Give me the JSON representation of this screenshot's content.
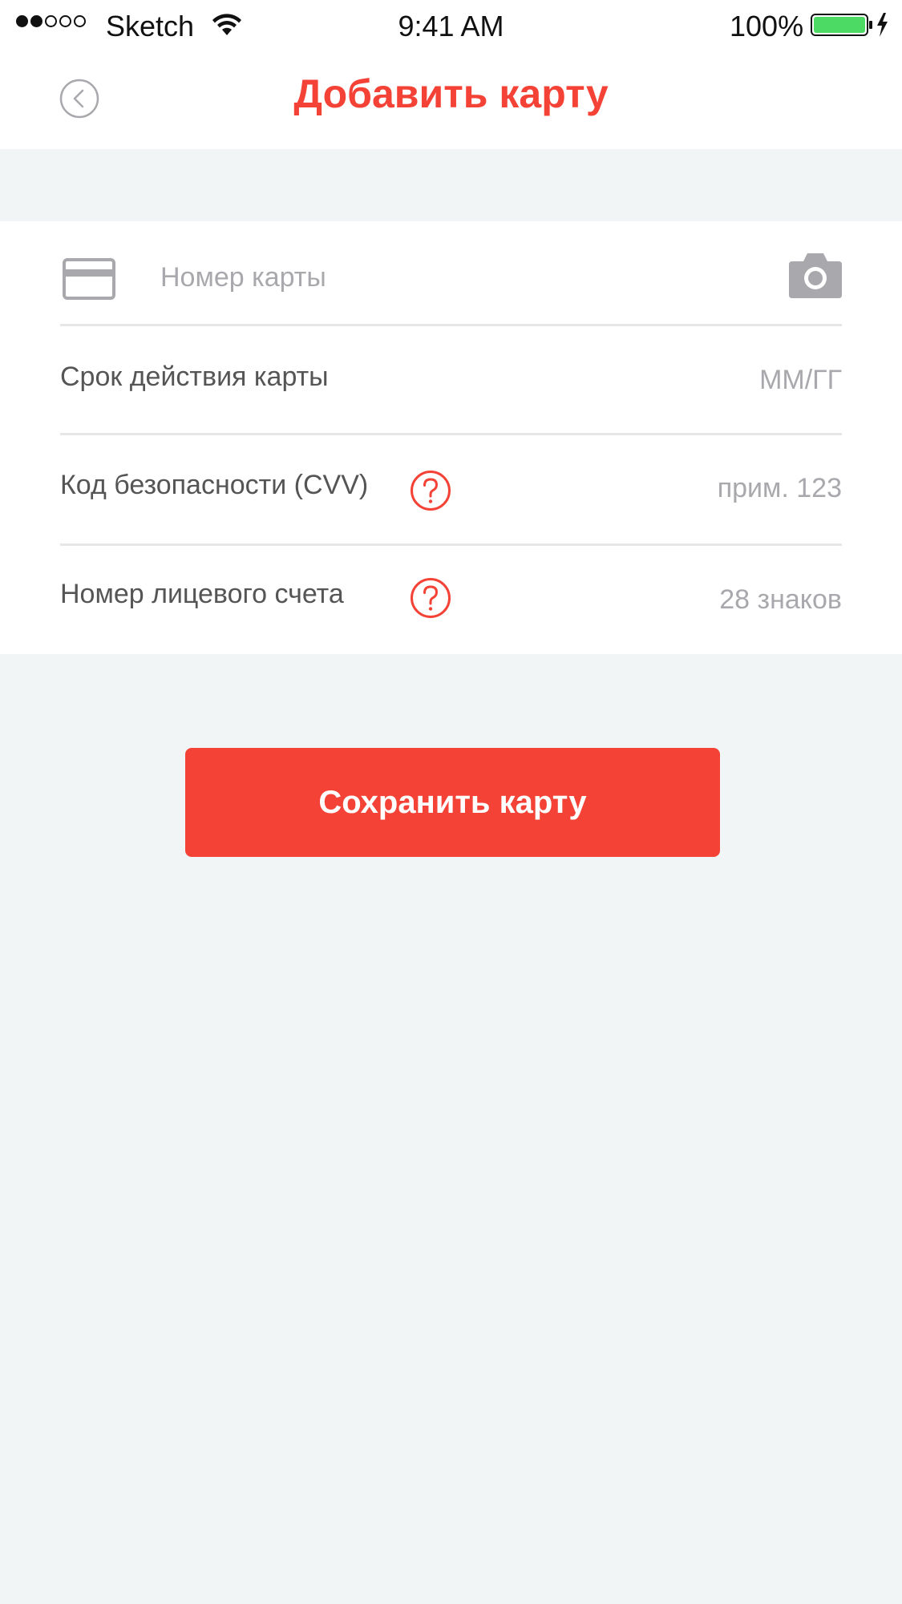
{
  "status_bar": {
    "carrier": "Sketch",
    "time": "9:41 AM",
    "battery_percent": "100%",
    "signal_bars_filled": 2,
    "signal_bars_total": 5,
    "battery_color": "#4cd964"
  },
  "header": {
    "title": "Добавить карту",
    "back_icon": "chevron-left-icon"
  },
  "form": {
    "card_number": {
      "placeholder": "Номер карты",
      "value": "",
      "icon": "credit-card-icon",
      "scan_icon": "camera-icon"
    },
    "expiry": {
      "label": "Срок действия карты",
      "placeholder": "ММ/ГГ",
      "value": ""
    },
    "cvv": {
      "label": "Код безопасности (CVV)",
      "placeholder": "прим. 123",
      "value": "",
      "help_icon": "question-icon"
    },
    "account_number": {
      "label": "Номер лицевого счета",
      "placeholder": "28 знаков",
      "value": "",
      "help_icon": "question-icon"
    }
  },
  "save_button": {
    "label": "Сохранить карту"
  },
  "colors": {
    "accent": "#f44336",
    "background": "#f2f5f6",
    "placeholder": "#a9a9ad",
    "label": "#555555"
  }
}
